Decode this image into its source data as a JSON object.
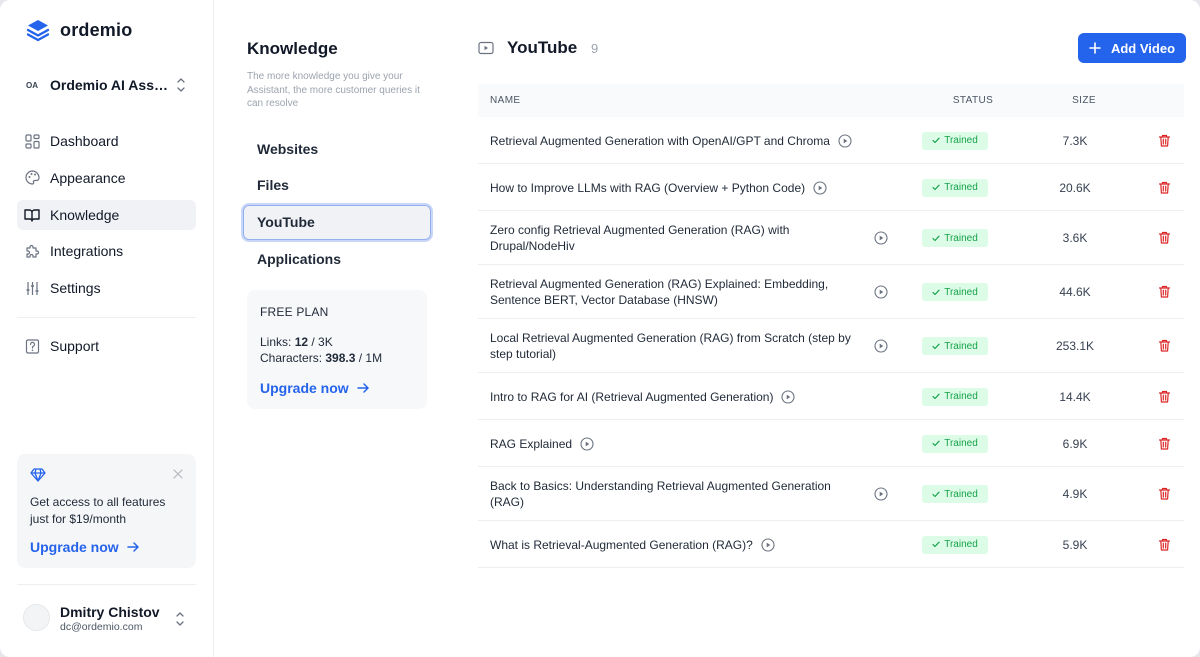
{
  "brand": {
    "name": "ordemio"
  },
  "workspace": {
    "badge": "OA",
    "name": "Ordemio AI Assistant"
  },
  "sidebar": {
    "items": [
      {
        "label": "Dashboard",
        "icon": "dashboard-icon"
      },
      {
        "label": "Appearance",
        "icon": "palette-icon"
      },
      {
        "label": "Knowledge",
        "icon": "book-icon",
        "active": true
      },
      {
        "label": "Integrations",
        "icon": "puzzle-icon"
      },
      {
        "label": "Settings",
        "icon": "sliders-icon"
      }
    ],
    "support": {
      "label": "Support",
      "icon": "help-icon"
    }
  },
  "promo": {
    "icon": "diamond-icon",
    "text": "Get access to all features just for $19/month",
    "link": "Upgrade now"
  },
  "user": {
    "name": "Dmitry Chistov",
    "email": "dc@ordemio.com"
  },
  "knowledge": {
    "title": "Knowledge",
    "subtitle": "The more knowledge you give your Assistant, the more customer queries it can resolve",
    "nav": [
      {
        "label": "Websites"
      },
      {
        "label": "Files"
      },
      {
        "label": "YouTube",
        "active": true
      },
      {
        "label": "Applications"
      }
    ],
    "plan": {
      "title": "FREE PLAN",
      "links_label": "Links: ",
      "links_used": "12",
      "links_limit": " / 3K",
      "chars_label": "Characters: ",
      "chars_used": "398.3",
      "chars_limit": " / 1M",
      "upgrade": "Upgrade now"
    }
  },
  "main": {
    "title": "YouTube",
    "count": "9",
    "add_button": "Add Video",
    "columns": {
      "name": "NAME",
      "status": "STATUS",
      "size": "SIZE"
    },
    "rows": [
      {
        "name": "Retrieval Augmented Generation with OpenAI/GPT and Chroma",
        "status": "Trained",
        "size": "7.3K"
      },
      {
        "name": "How to Improve LLMs with RAG (Overview + Python Code)",
        "status": "Trained",
        "size": "20.6K"
      },
      {
        "name": "Zero config Retrieval Augmented Generation (RAG) with Drupal/NodeHiv",
        "status": "Trained",
        "size": "3.6K"
      },
      {
        "name": "Retrieval Augmented Generation (RAG) Explained: Embedding, Sentence BERT, Vector Database (HNSW)",
        "status": "Trained",
        "size": "44.6K"
      },
      {
        "name": "Local Retrieval Augmented Generation (RAG) from Scratch (step by step tutorial)",
        "status": "Trained",
        "size": "253.1K"
      },
      {
        "name": "Intro to RAG for AI (Retrieval Augmented Generation)",
        "status": "Trained",
        "size": "14.4K"
      },
      {
        "name": "RAG Explained",
        "status": "Trained",
        "size": "6.9K"
      },
      {
        "name": "Back to Basics: Understanding Retrieval Augmented Generation (RAG)",
        "status": "Trained",
        "size": "4.9K"
      },
      {
        "name": "What is Retrieval-Augmented Generation (RAG)?",
        "status": "Trained",
        "size": "5.9K"
      }
    ]
  },
  "colors": {
    "accent": "#2463eb",
    "trained_bg": "#dcfce7",
    "trained_text": "#16a34a",
    "delete": "#dc2626"
  }
}
